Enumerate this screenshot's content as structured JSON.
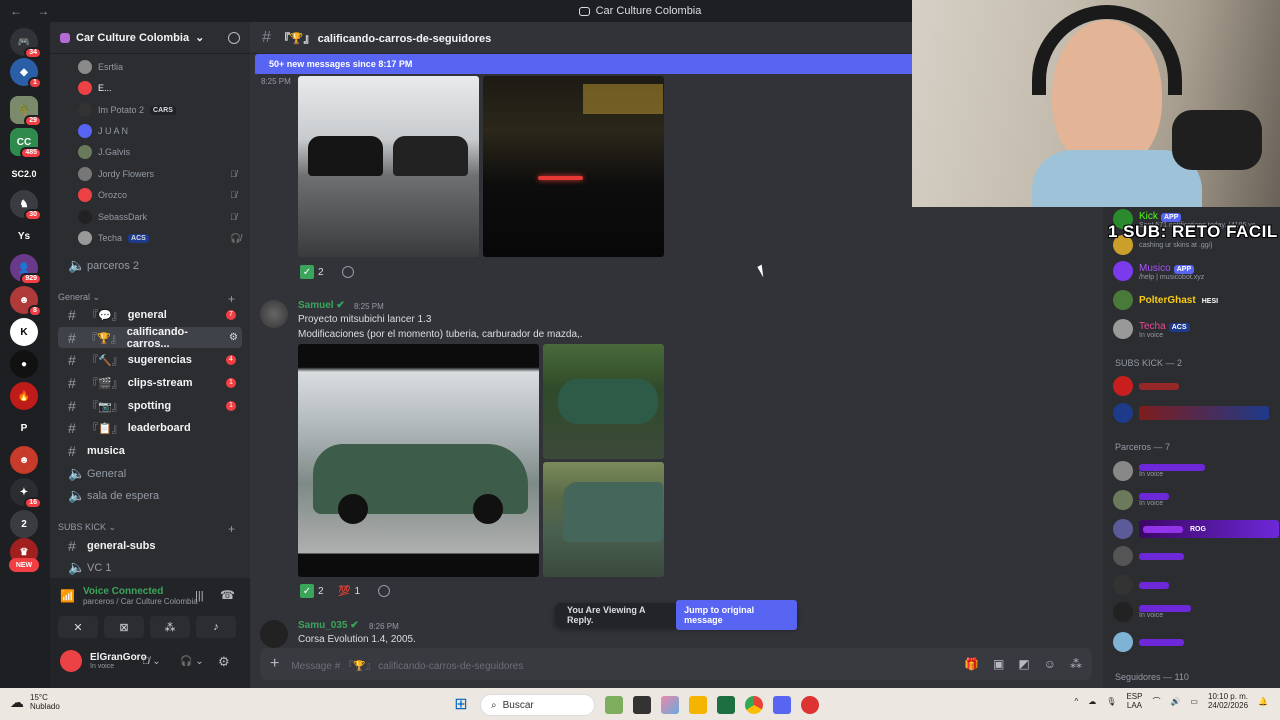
{
  "window": {
    "title": "Car Culture Colombia"
  },
  "servers": {
    "badges": [
      "34",
      "1",
      "29",
      "485",
      "",
      "30",
      "",
      "929",
      "8",
      "",
      "",
      "",
      "",
      "16",
      "",
      ""
    ],
    "labels": {
      "sc": "SC2.0",
      "ys": "Ys",
      "p": "P",
      "new": "NEW"
    }
  },
  "sidebar": {
    "server_name": "Car Culture Colombia",
    "voice_users": [
      {
        "name": "Esrtlia"
      },
      {
        "name": "E..."
      },
      {
        "name": "Im Potato 2",
        "tag": "CARS"
      },
      {
        "name": "J U A N"
      },
      {
        "name": "J.Galvis"
      },
      {
        "name": "Jordy Flowers"
      },
      {
        "name": "Orozco"
      },
      {
        "name": "SebassDark"
      },
      {
        "name": "Techa",
        "tag": "ACS"
      }
    ],
    "voice_channel_2": "parceros 2",
    "category_general": "General",
    "channels": [
      {
        "prefix": "『💬』",
        "name": "general",
        "count": "7"
      },
      {
        "prefix": "『🏆』",
        "name": "calificando-carros...",
        "count": ""
      },
      {
        "prefix": "『🔨』",
        "name": "sugerencias",
        "count": "4"
      },
      {
        "prefix": "『🎬』",
        "name": "clips-stream",
        "count": "1"
      },
      {
        "prefix": "『📷』",
        "name": "spotting",
        "count": "1"
      },
      {
        "prefix": "『📋』",
        "name": "leaderboard",
        "count": ""
      }
    ],
    "musica": "musica",
    "voice_general": "General",
    "voice_espera": "sala de espera",
    "category_subs": "SUBS KICK",
    "general_subs": "general-subs",
    "vc1": "VC 1"
  },
  "voice_status": {
    "label": "Voice Connected",
    "location": "parceros / Car Culture Colombia"
  },
  "user": {
    "name": "ElGranGoro",
    "status": "In voice"
  },
  "chat": {
    "channel_name": "『🏆』 calificando-carros-de-seguidores",
    "new_messages_banner": "50+ new messages since 8:17 PM",
    "first_time": "8:25 PM",
    "reactions_1": {
      "check": "2"
    },
    "message_2": {
      "author": "Samuel",
      "time": "8:25 PM",
      "line1": "Proyecto mitsubichi lancer 1.3",
      "line2": "Modificaciones (por el momento) tuberia, carburador de mazda,."
    },
    "reactions_2": {
      "check": "2",
      "other": "1"
    },
    "message_3": {
      "author": "Samu_035",
      "time": "8:26 PM",
      "line1": "Corsa Evolution 1.4, 2005."
    },
    "reply_notice": "You Are Viewing A Reply.",
    "jump_button": "Jump to original message",
    "composer_placeholder": "Message # 『🏆』 calificando-carros-de-seguidores"
  },
  "members": {
    "top": [
      {
        "name": "Kick",
        "tag": "APP",
        "status": "Sent 571 notifications today. (4196 ye",
        "color": "#53fc18"
      },
      {
        "name": "",
        "tag": "",
        "status": "cashing ur skins at .gg/j",
        "color": "#949ba4"
      },
      {
        "name": "Musico",
        "tag": "APP",
        "status": "/help | musicobot.xyz",
        "color": "#a855f7"
      },
      {
        "name": "PolterGhast",
        "tag": "HESI",
        "status": "",
        "color": "#facc15"
      },
      {
        "name": "Techa",
        "tag": "ACS",
        "status": "In voice",
        "color": "#ec4899"
      }
    ],
    "subs_header": "SUBS KICK — 2",
    "parceros_header": "Parceros — 7",
    "parceros_status": [
      "In voice",
      "In voice",
      "",
      "",
      "",
      "In voice",
      ""
    ],
    "rog_tag": "ROG",
    "seguidores_header": "Seguidores — 110"
  },
  "overlay": {
    "text": "1 SUB: RETO FACIL"
  },
  "taskbar": {
    "temp": "15°C",
    "weather": "Nublado",
    "search": "Buscar",
    "lang": "ESP",
    "lang2": "LAA",
    "time": "10:10 p. m.",
    "date": "24/02/2026"
  },
  "colors": {
    "accent": "#5865f2",
    "green": "#3ba55c",
    "red": "#f23f43"
  }
}
